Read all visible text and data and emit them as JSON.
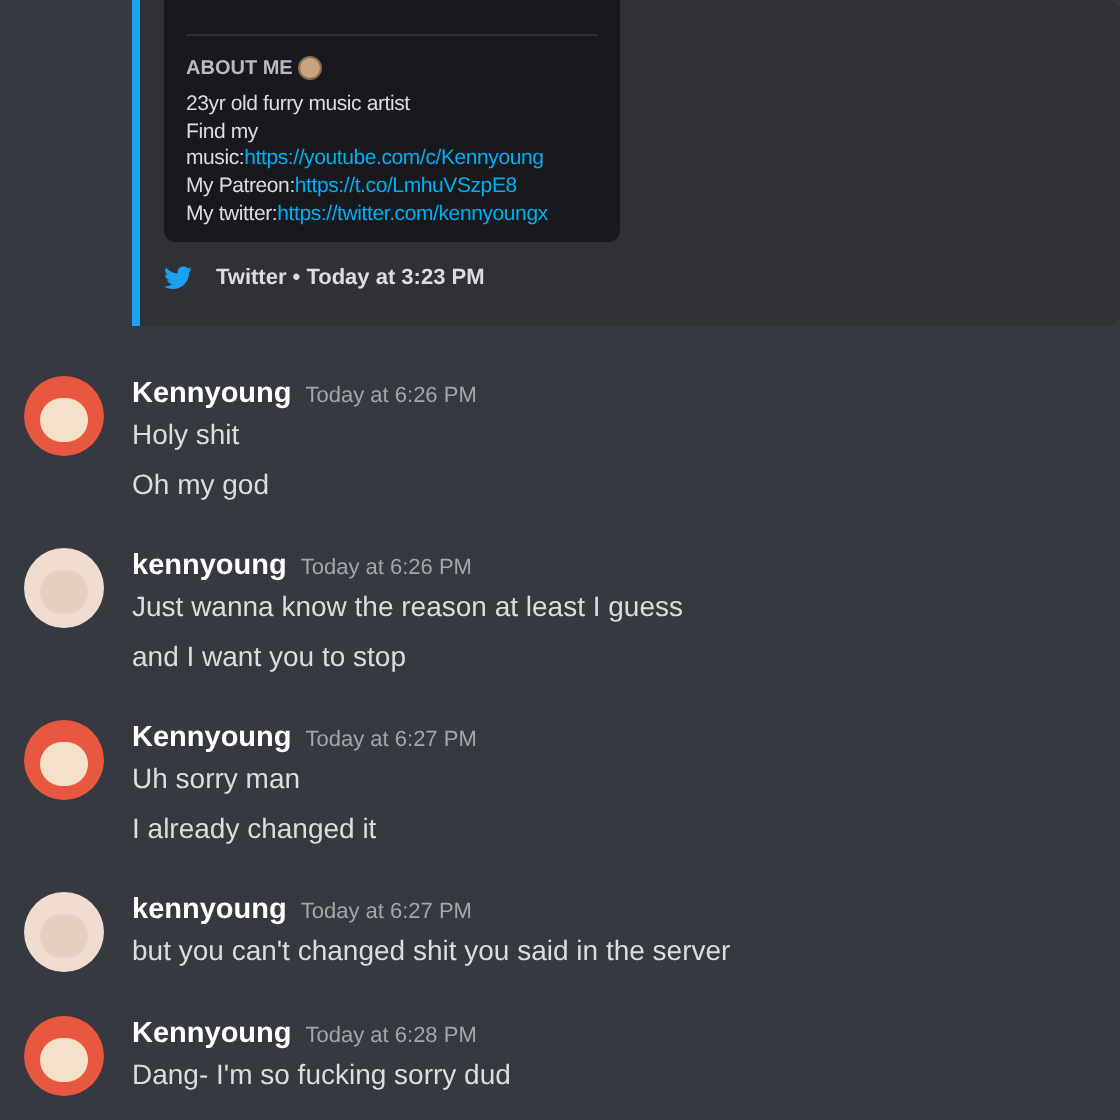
{
  "embed": {
    "about_title": "ABOUT ME",
    "about_lines": [
      {
        "text": "23yr old furry music artist"
      },
      {
        "text": "Find my"
      },
      {
        "text": "music:",
        "link": "https://youtube.com/c/Kennyoung"
      },
      {
        "text": "My Patreon:",
        "link": "https://t.co/LmhuVSzpE8"
      },
      {
        "text": "My twitter:",
        "link": "https://twitter.com/kennyoungx"
      }
    ],
    "footer": {
      "source": "Twitter",
      "separator": "•",
      "time": "Today at 3:23 PM"
    }
  },
  "messages": [
    {
      "author": "Kennyoung",
      "time": "Today at 6:26 PM",
      "kind": "red",
      "lines": [
        "Holy shit",
        "Oh my god"
      ]
    },
    {
      "author": "kennyoung",
      "time": "Today at 6:26 PM",
      "kind": "pale",
      "lines": [
        "Just wanna know the reason at least I guess",
        "and I want you to stop"
      ]
    },
    {
      "author": "Kennyoung",
      "time": "Today at 6:27 PM",
      "kind": "red",
      "lines": [
        "Uh sorry man",
        "I already changed it"
      ]
    },
    {
      "author": "kennyoung",
      "time": "Today at 6:27 PM",
      "kind": "pale",
      "lines": [
        "but you can't changed shit you said in the server"
      ]
    },
    {
      "author": "Kennyoung",
      "time": "Today at 6:28 PM",
      "kind": "red",
      "lines": [
        "Dang- I'm so fucking sorry dud"
      ]
    }
  ]
}
